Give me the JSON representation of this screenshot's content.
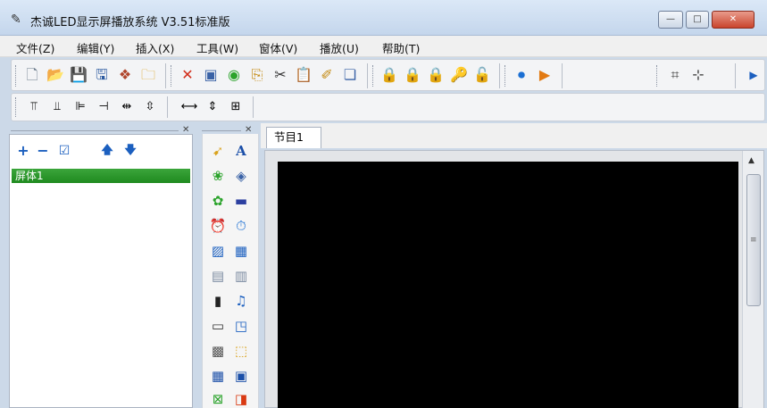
{
  "window": {
    "title": "杰诚LED显示屏播放系统 V3.51标准版",
    "controls": {
      "minimize": "—",
      "maximize": "□",
      "close": "✕"
    }
  },
  "menu": [
    "文件(Z)",
    "编辑(Y)",
    "插入(X)",
    "工具(W)",
    "窗体(V)",
    "播放(U)",
    "帮助(T)"
  ],
  "toolbar1": {
    "icons": [
      "new-file",
      "open-folder",
      "save",
      "save-as",
      "tools",
      "folder",
      "delete",
      "select",
      "back",
      "copy",
      "cut",
      "paste",
      "edit",
      "clip",
      "lock-1",
      "lock-2",
      "lock-3",
      "key",
      "unlock",
      "stop-circle",
      "play-circle",
      "screen-select",
      "screen-move",
      "more"
    ]
  },
  "toolbar2": {
    "icons": [
      "align-top",
      "align-middle",
      "align-left",
      "align-right",
      "distribute-h",
      "distribute-v",
      "fit-width",
      "fit-height",
      "fit-both"
    ]
  },
  "left_panel": {
    "toolbar": {
      "add": "+",
      "remove": "−",
      "check": "☑",
      "up": "🡅",
      "down": "🡇"
    },
    "items": [
      "屏体1"
    ]
  },
  "tools": {
    "letter_a": "A"
  },
  "tabs": [
    "节目1"
  ]
}
